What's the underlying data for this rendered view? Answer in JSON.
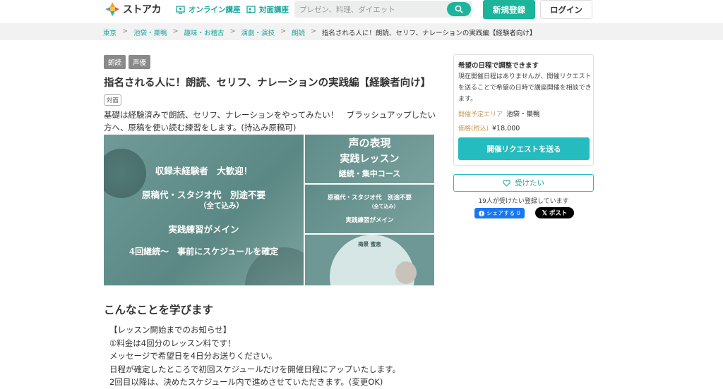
{
  "header": {
    "logo_text": "ストアカ",
    "nav_online": "オンライン講座",
    "nav_offline": "対面講座",
    "search_placeholder": "プレゼン、料理、ダイエット",
    "signup_label": "新規登録",
    "login_label": "ログイン"
  },
  "breadcrumbs": [
    "東京",
    "池袋・巣鴨",
    "趣味・お稽古",
    "演劇・演技",
    "朗読",
    "指名される人に！朗読、セリフ、ナレーションの実践編【経験者向け】"
  ],
  "course": {
    "tags": [
      "朗読",
      "声優"
    ],
    "title": "指名される人に！朗読、セリフ、ナレーションの実践編【経験者向け】",
    "format_badge": "対面",
    "description_line1": "基礎は経験済みで朗読、セリフ、ナレーションをやってみたい！　ブラッシュアップしたい",
    "description_line2": "方へ、原稿を使い読む練習をします。(持込み原稿可)"
  },
  "gallery": {
    "main": {
      "line1": "収録未経験者　大歓迎！",
      "line2": "原稿代・スタジオ代　別途不要",
      "line3": "（全て込み）",
      "line4": "実践練習がメイン",
      "line5": "4回継続～　事前にスケジュールを確定"
    },
    "thumb1": {
      "line1": "声の表現",
      "line2": "実践レッスン",
      "line3": "継続・集中コース"
    },
    "thumb2": {
      "line1": "原稿代・スタジオ代　別途不要",
      "line2": "（全て込み）",
      "line3": "実践練習がメイン"
    },
    "thumb3": {
      "line1": "梅景 蜜恵"
    }
  },
  "learn": {
    "heading": "こんなことを学びます",
    "lines": [
      "【レッスン開始までのお知らせ】",
      "①料金は4回分のレッスン料です！",
      "メッセージで希望日を4日分お送りください。",
      "日程が確定したところで初回スケジュールだけを開催日程にアップいたします。",
      "2回目以降は、決めたスケジュール内で進めさせていただきます。(変更OK)"
    ]
  },
  "sidebar": {
    "card_title": "希望の日程で調整できます",
    "card_text": "現在開催日程はありませんが、開催リクエストを送ることで希望の日時で講座開催を相談できます。",
    "area_label": "開催予定エリア",
    "area_value": "池袋・巣鴨",
    "price_label": "価格(税込)",
    "price_value": "¥18,000",
    "request_button": "開催リクエストを送る",
    "want_button": "受けたい",
    "want_count": "19人が受けたい登録しています",
    "fb_share": "シェアする 0",
    "x_post": "ポスト"
  },
  "colors": {
    "brand": "#1cb49a",
    "cta": "#25bcc0",
    "link": "#1aa89c",
    "tag_bg": "#8a8a8a"
  }
}
